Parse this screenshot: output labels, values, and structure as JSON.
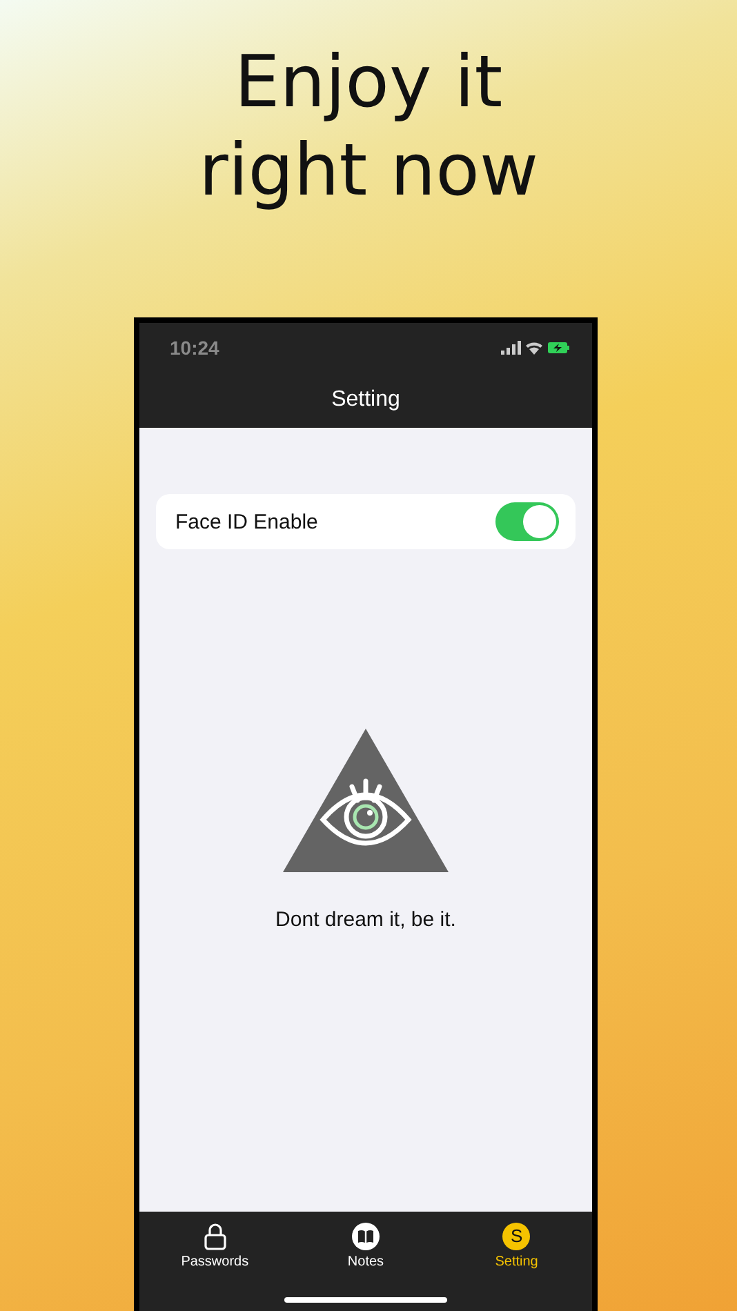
{
  "headline": [
    "Enjoy it",
    "right now"
  ],
  "status_bar": {
    "time": "10:24"
  },
  "nav": {
    "title": "Setting"
  },
  "settings": [
    {
      "label": "Face ID Enable",
      "on": true
    }
  ],
  "motto": "Dont dream it, be it.",
  "tabs": [
    {
      "label": "Passwords",
      "kind": "lock",
      "selected": false
    },
    {
      "label": "Notes",
      "kind": "book",
      "selected": false
    },
    {
      "label": "Setting",
      "kind": "letter",
      "icon_letter": "S",
      "selected": true
    }
  ]
}
